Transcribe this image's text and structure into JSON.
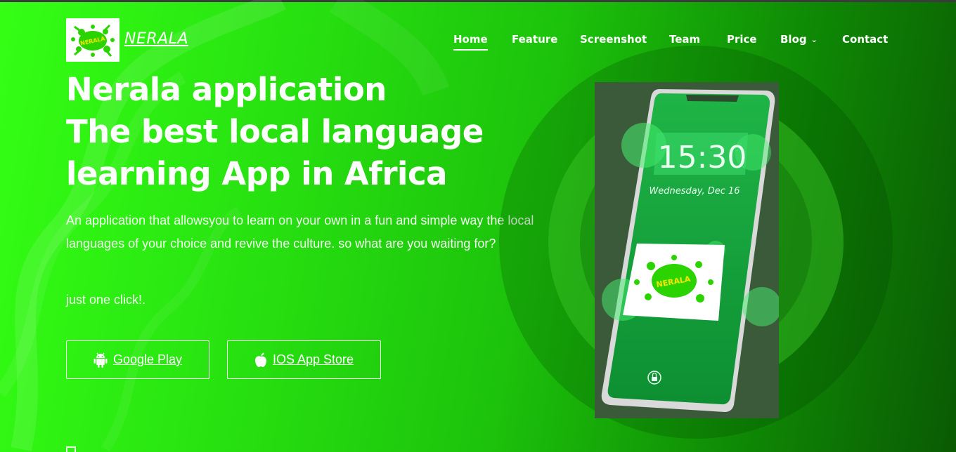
{
  "header": {
    "brand_name": "NERALA",
    "logo_text": "NERALA",
    "nav": [
      {
        "label": "Home",
        "active": true
      },
      {
        "label": "Feature",
        "active": false
      },
      {
        "label": "Screenshot",
        "active": false
      },
      {
        "label": "Team",
        "active": false
      },
      {
        "label": "Price",
        "active": false
      },
      {
        "label": "Blog",
        "active": false,
        "has_dropdown": true
      },
      {
        "label": "Contact",
        "active": false
      }
    ]
  },
  "hero": {
    "title_lines": [
      "Nerala application",
      "The best local language",
      "learning App in Africa"
    ],
    "description": "An application that allowsyou to learn on your own in a fun and simple way the local languages of your choice and revive the culture. so what are you waiting for?",
    "cta_text": "just one click!.",
    "buttons": [
      {
        "label": "Google Play",
        "icon": "android-icon"
      },
      {
        "label": "IOS App Store",
        "icon": "apple-icon"
      }
    ]
  },
  "phone": {
    "time": "15:30",
    "date": "Wednesday, Dec 16",
    "logo_text": "NERALA",
    "icon": "lock-icon"
  },
  "colors": {
    "bg_left": "#34ff14",
    "bg_right": "#0a5a03",
    "text": "#ffffff",
    "phone_green": "#18a83a",
    "logo_splash": "#2bd400"
  }
}
